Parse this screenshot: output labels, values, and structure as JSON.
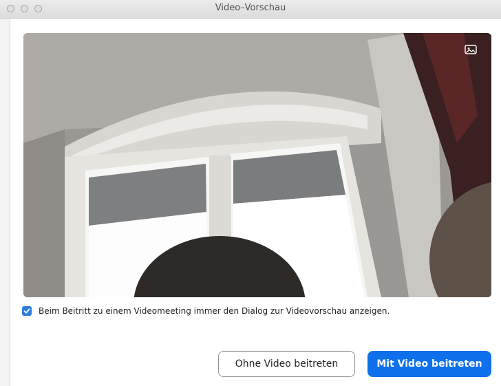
{
  "window": {
    "title": "Video–Vorschau"
  },
  "preview": {
    "toggle_icon": "picture-icon"
  },
  "options": {
    "show_preview_label": "Beim Beitritt zu einem Videomeeting immer den Dialog zur Videovorschau anzeigen.",
    "show_preview_checked": true
  },
  "actions": {
    "join_without_video": "Ohne Video beitreten",
    "join_with_video": "Mit Video beitreten"
  },
  "colors": {
    "primary": "#0e71eb",
    "checkbox": "#2f7de1"
  }
}
